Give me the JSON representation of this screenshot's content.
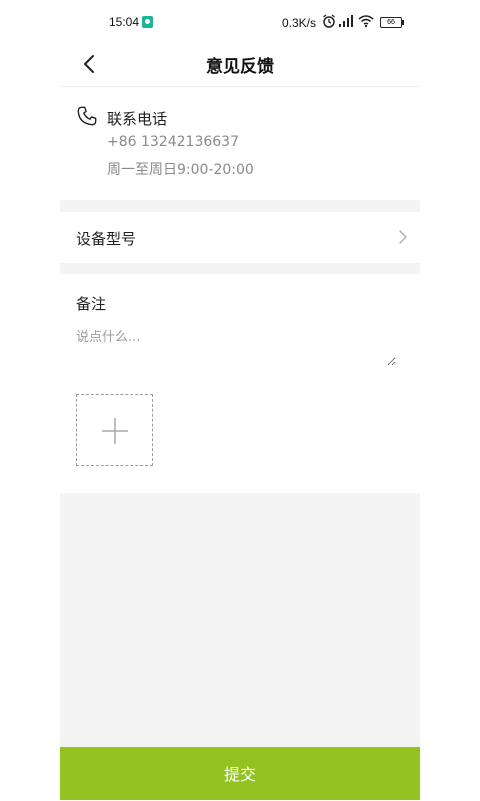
{
  "status_bar": {
    "time": "15:04",
    "network_speed": "0.3K/s",
    "battery": "66",
    "icons": [
      "shield-icon",
      "alarm-icon",
      "signal-icon",
      "wifi-icon",
      "battery-icon"
    ]
  },
  "header": {
    "title": "意见反馈",
    "back_icon": "chevron-left-icon"
  },
  "contact": {
    "label": "联系电话",
    "phone": "+86 13242136637",
    "hours": "周一至周日9:00-20:00",
    "icon": "phone-icon"
  },
  "device": {
    "label": "设备型号",
    "icon": "chevron-right-icon"
  },
  "note": {
    "label": "备注",
    "placeholder": "说点什么...",
    "value": "",
    "add_icon": "plus-icon"
  },
  "submit_label": "提交",
  "colors": {
    "accent": "#92c321",
    "divider": "#f4f4f4",
    "secondary_text": "#8a8a8a"
  }
}
